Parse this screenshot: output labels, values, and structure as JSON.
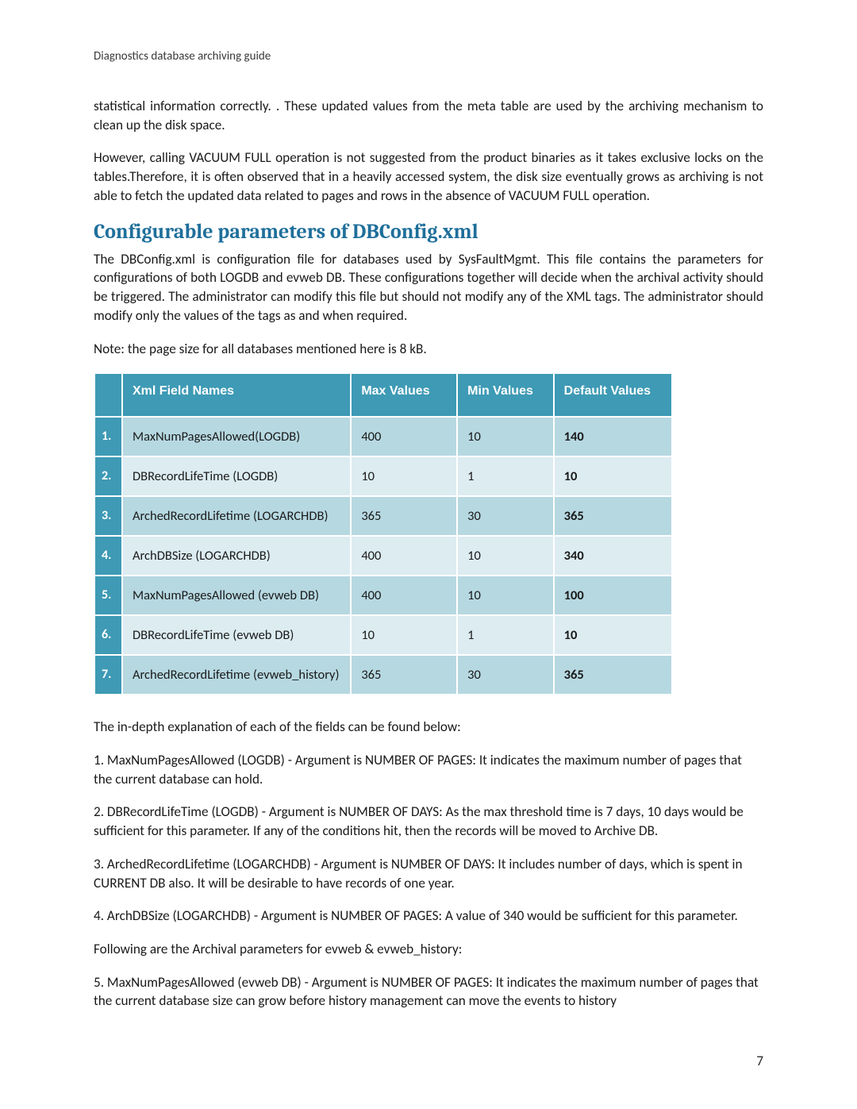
{
  "header": {
    "doc_title": "Diagnostics database archiving guide"
  },
  "para_intro1": "statistical information correctly. . These updated values from the meta table are used by the archiving mechanism to clean up the disk space.",
  "para_intro2": "However, calling VACUUM FULL operation is not suggested from the product binaries as it takes exclusive locks on the tables.Therefore, it is often observed that in a heavily accessed system, the disk size eventually grows as archiving is not able to fetch the updated data related to pages and rows in the absence of VACUUM FULL operation.",
  "section_title": "Configurable parameters of DBConfig.xml",
  "para_config": "The DBConfig.xml is configuration file for databases used by SysFaultMgmt.  This file contains the parameters for configurations of both LOGDB and evweb DB. These configurations together will decide when the archival activity should be triggered. The administrator can modify this file but should not modify any of the XML tags. The administrator should modify only the values of the tags as and when required.",
  "para_note": " Note: the page size for all databases mentioned here is 8 kB.",
  "table": {
    "headers": {
      "c1": "Xml Field Names",
      "c2": "Max Values",
      "c3": "Min Values",
      "c4": "Default Values"
    },
    "rows": [
      {
        "num": "1.",
        "name": "MaxNumPagesAllowed(LOGDB)",
        "max": "400",
        "min": "10",
        "def": "140"
      },
      {
        "num": "2.",
        "name": "DBRecordLifeTime (LOGDB)",
        "max": "10",
        "min": "1",
        "def": "10"
      },
      {
        "num": "3.",
        "name": "ArchedRecordLifetime (LOGARCHDB)",
        "max": "365",
        "min": "30",
        "def": "365"
      },
      {
        "num": "4.",
        "name": "ArchDBSize (LOGARCHDB)",
        "max": "400",
        "min": "10",
        "def": "340"
      },
      {
        "num": "5.",
        "name": "MaxNumPagesAllowed (evweb DB)",
        "max": "400",
        "min": "10",
        "def": "100"
      },
      {
        "num": "6.",
        "name": "DBRecordLifeTime (evweb DB)",
        "max": "10",
        "min": "1",
        "def": "10"
      },
      {
        "num": "7.",
        "name": "ArchedRecordLifetime (evweb_history)",
        "max": "365",
        "min": "30",
        "def": "365"
      }
    ]
  },
  "para_below": " The in-depth explanation of each of the fields can be found below:",
  "exp1": "1. MaxNumPagesAllowed (LOGDB) - Argument is NUMBER OF PAGES: It indicates the maximum number of pages that the current database can hold.",
  "exp2": " 2. DBRecordLifeTime (LOGDB) - Argument is NUMBER OF DAYS: As the max threshold time is 7 days, 10 days would be sufficient for this parameter. If any of the conditions hit, then the records will be moved to Archive DB.",
  "exp3": "3. ArchedRecordLifetime (LOGARCHDB) - Argument is NUMBER OF DAYS: It includes number of days, which is spent in CURRENT DB also. It will be desirable to have records of one year.",
  "exp4": "4. ArchDBSize (LOGARCHDB) - Argument is NUMBER OF PAGES: A value of 340 would be sufficient for this parameter.",
  "exp_subhead": " Following are the Archival parameters for evweb & evweb_history:",
  "exp5": "5. MaxNumPagesAllowed (evweb DB) - Argument is NUMBER OF PAGES: It indicates the maximum number of pages that the current database size can grow before history management can move the events to history",
  "page_number": "7"
}
